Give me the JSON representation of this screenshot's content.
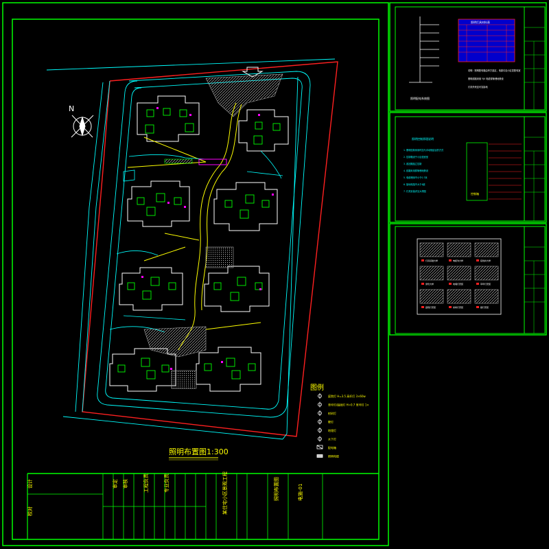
{
  "colors": {
    "frame": "#00ff00",
    "site_boundary": "#ff2020",
    "road": "#00ffff",
    "building": "#ffffff",
    "path": "#ffff00",
    "accent": "#ff00ff",
    "title_yellow": "#ffff00",
    "table_blue": "#0000cc"
  },
  "main_sheet": {
    "plan_title": "照明布置图1:300",
    "north_label": "N",
    "legend": {
      "title": "图例",
      "items": [
        {
          "symbol": "lamp-a",
          "text": "庭院灯 H=3.5 高杆灯 3×60w"
        },
        {
          "symbol": "lamp-b",
          "text": "草坪灯/庭园灯 H=0.7 草坪灯 1×"
        },
        {
          "symbol": "lamp-c",
          "text": "射树灯"
        },
        {
          "symbol": "lamp-d",
          "text": "壁灯"
        },
        {
          "symbol": "lamp-e",
          "text": "地埋灯"
        },
        {
          "symbol": "lamp-f",
          "text": "水下灯"
        },
        {
          "symbol": "box",
          "text": "配电箱"
        },
        {
          "symbol": "bar",
          "text": "照明电缆"
        }
      ]
    },
    "title_block": {
      "cells_left": [
        "设计",
        "校对"
      ],
      "cells_mid": [
        "审定",
        "审核",
        "工程负责",
        "专业负责"
      ],
      "project": "某住宅小区景观工程",
      "drawing_name": "照明布置图",
      "drawing_no": "电施-01"
    }
  },
  "sheet_a": {
    "table_title": "照明灯具材料表",
    "notes": [
      "说明：照明配电箱由甲方选定，电源引自小区变配电室",
      "照明线路采用 YJV 电缆穿管埋地敷设",
      "灯具外壳应可靠接地"
    ],
    "schematic_label": "照明配电系统图"
  },
  "sheet_b": {
    "heading": "照明控制原理说明",
    "notes": [
      "1. 照明控制采用时控与手动相结合的方式",
      "2. 控制箱设于小区值班室",
      "3. 各回路独立控制",
      "4. 线路采用穿管埋地敷设",
      "5. 电缆埋深不小于0.7米",
      "6. 接地电阻不大于4欧",
      "7. 灯具安装详见大样图"
    ],
    "box_label": "控制箱"
  },
  "sheet_c": {
    "details": [
      "灯具基础大样",
      "电缆沟大样",
      "接线井大样",
      "穿管大样",
      "地埋灯安装",
      "草坪灯安装",
      "庭院灯安装",
      "射树灯安装",
      "壁灯安装"
    ]
  }
}
